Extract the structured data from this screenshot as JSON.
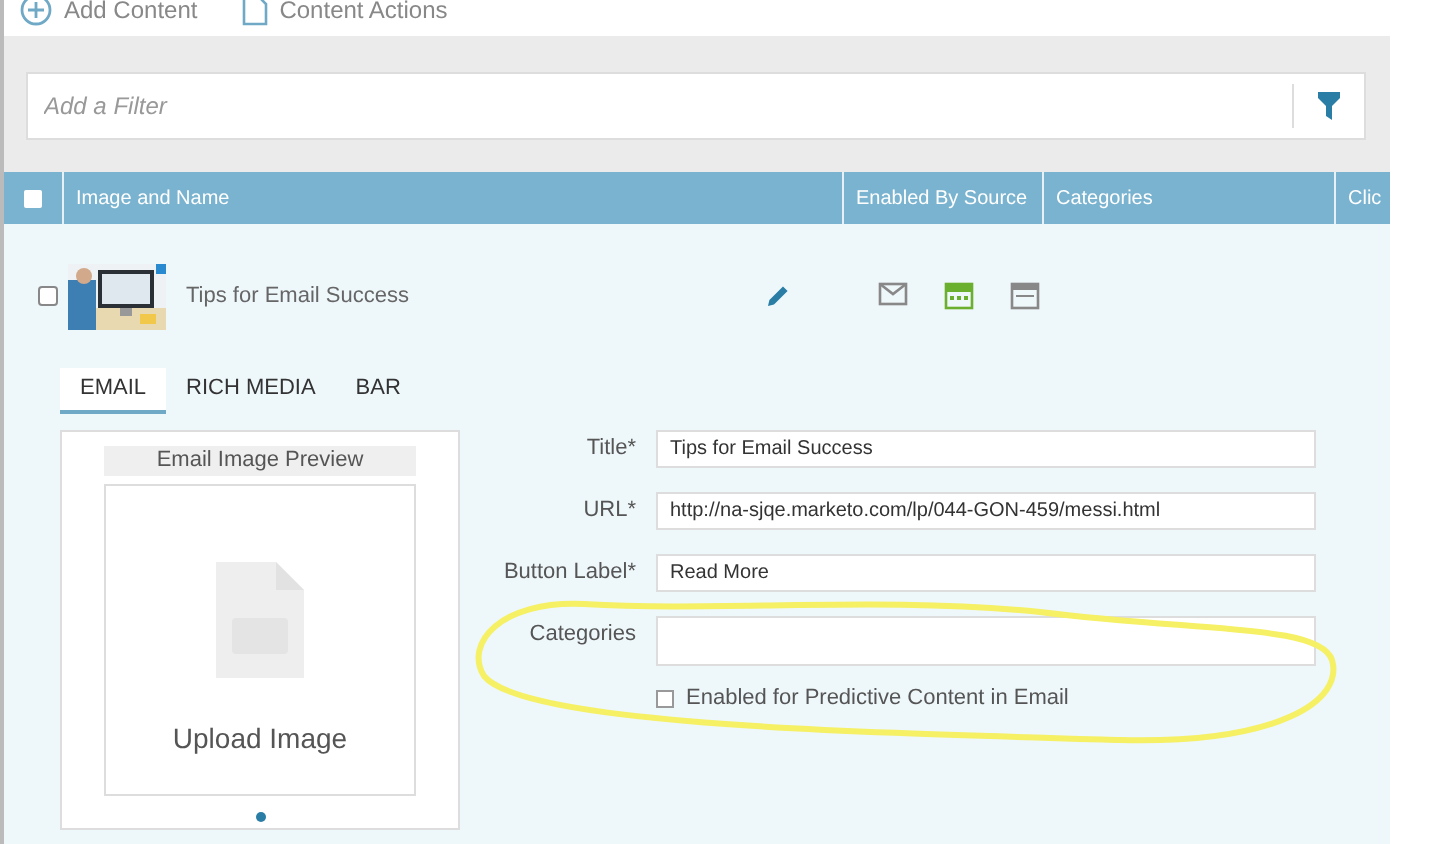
{
  "toolbar": [
    {
      "kind": "add",
      "label": "Add Content"
    },
    {
      "kind": "document",
      "label": "Content Actions"
    }
  ],
  "filter": {
    "placeholder": "Add a Filter"
  },
  "table": {
    "select_all_checked": false,
    "columns": [
      "Image and Name",
      "Enabled By Source",
      "Categories",
      "Clic"
    ],
    "rows": [
      {
        "checked": false,
        "name": "Tips for Email Success",
        "sources": [
          {
            "kind": "email",
            "enabled": false
          },
          {
            "kind": "rich_media",
            "enabled": true
          },
          {
            "kind": "bar",
            "enabled": false
          }
        ],
        "tabs": [
          {
            "label": "EMAIL",
            "selected": true
          },
          {
            "label": "RICH MEDIA",
            "selected": false
          },
          {
            "label": "BAR",
            "selected": false
          }
        ],
        "preview": {
          "title": "Email Image Preview",
          "upload_label": "Upload Image"
        },
        "fields": [
          {
            "label": "Title*",
            "value": "Tips for Email Success"
          },
          {
            "label": "URL*",
            "value": "http://na-sjqe.marketo.com/lp/044-GON-459/messi.html"
          },
          {
            "label": "Button Label*",
            "value": "Read More"
          },
          {
            "kind": "tall",
            "label": "Categories"
          }
        ],
        "predictive": {
          "label": "Enabled for Predictive Content in Email",
          "checked": false
        }
      }
    ]
  }
}
